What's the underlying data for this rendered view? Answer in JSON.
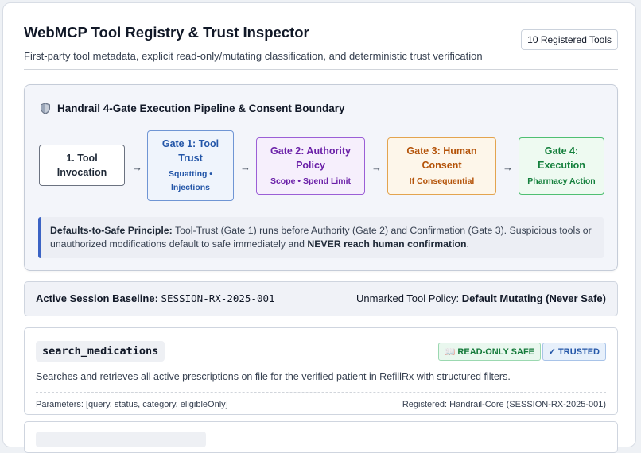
{
  "header": {
    "title": "WebMCP Tool Registry & Trust Inspector",
    "subtitle": "First-party tool metadata, explicit read-only/mutating classification, and deterministic trust verification",
    "registered_count": "10 Registered Tools"
  },
  "pipeline": {
    "title": "Handrail 4-Gate Execution Pipeline & Consent Boundary",
    "icon": "shield-icon",
    "gates": [
      {
        "title": "1. Tool Invocation",
        "sub": "",
        "color": "#1f2937"
      },
      {
        "title": "Gate 1: Tool Trust",
        "sub": "Squatting • Injections",
        "color": "#2456a8"
      },
      {
        "title": "Gate 2: Authority Policy",
        "sub": "Scope • Spend Limit",
        "color": "#6b21a8"
      },
      {
        "title": "Gate 3: Human Consent",
        "sub": "If Consequential",
        "color": "#b45309"
      },
      {
        "title": "Gate 4: Execution",
        "sub": "Pharmacy Action",
        "color": "#15803d"
      }
    ],
    "arrow": "→",
    "note": {
      "lead": "Defaults-to-Safe Principle:",
      "text": " Tool-Trust (Gate 1) runs before Authority (Gate 2) and Confirmation (Gate 3). Suspicious tools or unauthorized modifications default to safe immediately and ",
      "emphasis": "NEVER reach human confirmation",
      "tail": "."
    }
  },
  "session": {
    "baseline_label": "Active Session Baseline:",
    "baseline_value": "SESSION-RX-2025-001",
    "policy_label": "Unmarked Tool Policy:",
    "policy_value": "Default Mutating (Never Safe)"
  },
  "tools": [
    {
      "name": "search_medications",
      "badge_readonly": "📖 READ-ONLY SAFE",
      "badge_trusted": "✓ TRUSTED",
      "description": "Searches and retrieves all active prescriptions on file for the verified patient in RefillRx with structured filters.",
      "parameters": "Parameters: [query, status, category, eligibleOnly]",
      "registered": "Registered: Handrail-Core (SESSION-RX-2025-001)"
    }
  ]
}
